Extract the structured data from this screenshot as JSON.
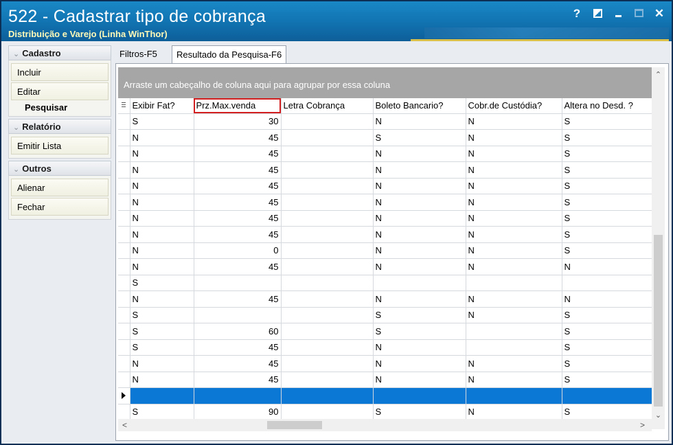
{
  "window": {
    "title": "522 - Cadastrar tipo de cobrança",
    "subtitle": "Distribuição e Varejo (Linha WinThor)",
    "controls": {
      "help": "?",
      "restore_icon": "restore-icon",
      "minimize_icon": "minimize-icon",
      "maximize_icon": "maximize-icon",
      "close": "✕"
    }
  },
  "sidebar": {
    "groups": [
      {
        "title": "Cadastro",
        "items": [
          "Incluir",
          "Editar"
        ],
        "extra_label": "Pesquisar"
      },
      {
        "title": "Relatório",
        "items": [
          "Emitir Lista"
        ]
      },
      {
        "title": "Outros",
        "items": [
          "Alienar",
          "Fechar"
        ]
      }
    ]
  },
  "tabs": [
    {
      "label": "Filtros-F5",
      "active": false
    },
    {
      "label": "Resultado da Pesquisa-F6",
      "active": true
    }
  ],
  "grid": {
    "group_hint": "Arraste um cabeçalho de coluna aqui para agrupar por essa coluna",
    "columns": [
      "Exibir Fat?",
      "Prz.Max.venda",
      "Letra Cobrança",
      "Boleto Bancario?",
      "Cobr.de Custódia?",
      "Altera no Desd. ?"
    ],
    "highlighted_column": "Prz.Max.venda",
    "rows": [
      [
        "S",
        "30",
        "",
        "N",
        "N",
        "S"
      ],
      [
        "N",
        "45",
        "",
        "S",
        "N",
        "S"
      ],
      [
        "N",
        "45",
        "",
        "N",
        "N",
        "S"
      ],
      [
        "N",
        "45",
        "",
        "N",
        "N",
        "S"
      ],
      [
        "N",
        "45",
        "",
        "N",
        "N",
        "S"
      ],
      [
        "N",
        "45",
        "",
        "N",
        "N",
        "S"
      ],
      [
        "N",
        "45",
        "",
        "N",
        "N",
        "S"
      ],
      [
        "N",
        "45",
        "",
        "N",
        "N",
        "S"
      ],
      [
        "N",
        "0",
        "",
        "N",
        "N",
        "S"
      ],
      [
        "N",
        "45",
        "",
        "N",
        "N",
        "N"
      ],
      [
        "S",
        "",
        "",
        "",
        "",
        ""
      ],
      [
        "N",
        "45",
        "",
        "N",
        "N",
        "N"
      ],
      [
        "S",
        "",
        "",
        "S",
        "N",
        "S"
      ],
      [
        "S",
        "60",
        "",
        "S",
        "",
        "S"
      ],
      [
        "S",
        "45",
        "",
        "N",
        "",
        "S"
      ],
      [
        "N",
        "45",
        "",
        "N",
        "N",
        "S"
      ],
      [
        "N",
        "45",
        "",
        "N",
        "N",
        "S"
      ],
      [
        "",
        "",
        "",
        "",
        "",
        ""
      ],
      [
        "S",
        "90",
        "",
        "S",
        "N",
        "S"
      ]
    ],
    "selected_row_index": 17,
    "accent_color": "#0a78d4",
    "highlight_color": "#d21e1e"
  }
}
